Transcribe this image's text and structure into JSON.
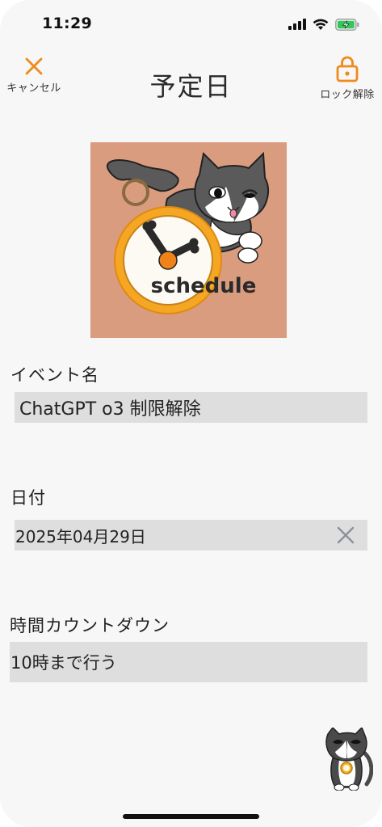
{
  "status_bar": {
    "time": "11:29"
  },
  "nav": {
    "cancel_label": "キャンセル",
    "title": "予定日",
    "unlock_label": "ロック解除"
  },
  "image": {
    "caption": "schedule"
  },
  "fields": {
    "event_name": {
      "label": "イベント名",
      "value": "ChatGPT o3 制限解除"
    },
    "date": {
      "label": "日付",
      "value": "2025年04月29日"
    },
    "countdown": {
      "label": "時間カウントダウン",
      "value": "10時まで行う"
    }
  },
  "colors": {
    "accent": "#f08a1c",
    "background": "#f7f7f7",
    "field_bg": "#dedede",
    "image_bg": "#d99c7f"
  }
}
